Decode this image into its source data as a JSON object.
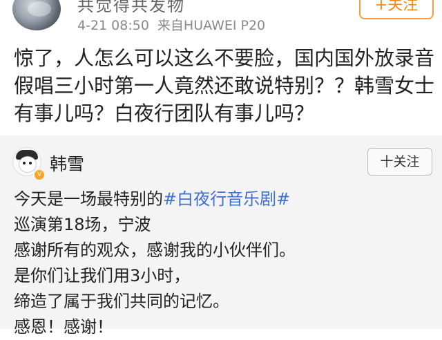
{
  "top_post": {
    "username": "共觉得共发物",
    "time": "4-21 08:50",
    "source": "来自HUAWEI P20",
    "follow_label": "+关注",
    "content": "惊了，人怎么可以这么不要脸，国内国外放录音假唱三小时第一人竟然还敢说特别？？韩雪女士有事儿吗？白夜行团队有事儿吗？"
  },
  "quoted_post": {
    "username": "韩雪",
    "follow_label": "十关注",
    "line1_prefix": "今天是一场最特别的",
    "hashtag": "#白夜行音乐剧#",
    "line2": "巡演第18场，宁波",
    "line3": "感谢所有的观众，感谢我的小伙伴们。",
    "line4": "是你们让我们用3小时，",
    "line5": "缔造了属于我们共同的记忆。",
    "line6": "感恩！感谢！"
  },
  "colors": {
    "accent_orange": "#f08a1a",
    "hashtag_blue": "#3f6fd0",
    "quoted_background": "#f4f4f4"
  },
  "icons": {
    "verified_badge": "v-badge-icon"
  }
}
